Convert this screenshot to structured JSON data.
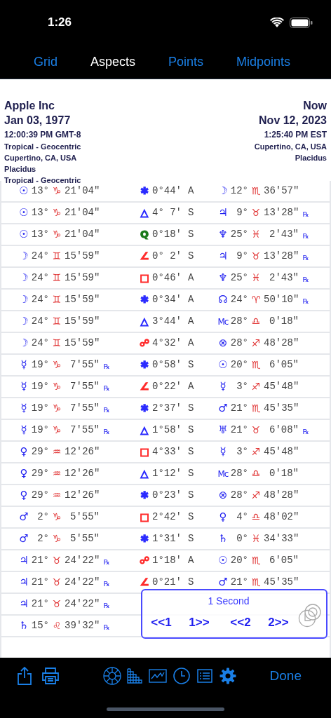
{
  "status_bar": {
    "time": "1:26"
  },
  "tabs": [
    {
      "label": "Grid",
      "selected": false
    },
    {
      "label": "Aspects",
      "selected": true
    },
    {
      "label": "Points",
      "selected": false
    },
    {
      "label": "Midpoints",
      "selected": false
    }
  ],
  "header": {
    "left": [
      {
        "kind": "title",
        "text": "Apple Inc"
      },
      {
        "kind": "date",
        "text": "Jan 03, 1977"
      },
      {
        "kind": "time",
        "text": "12:00:39 PM GMT-8"
      },
      {
        "kind": "detail",
        "text": "Tropical - Geocentric"
      },
      {
        "kind": "detail",
        "text": "Cupertino, CA, USA"
      },
      {
        "kind": "detail",
        "text": "Placidus"
      },
      {
        "kind": "detail",
        "text": "Tropical - Geocentric"
      }
    ],
    "right": [
      {
        "kind": "title",
        "text": "Now"
      },
      {
        "kind": "date",
        "text": "Nov 12, 2023"
      },
      {
        "kind": "time",
        "text": "1:25:40 PM EST"
      },
      {
        "kind": "detail",
        "text": "Cupertino, CA, USA"
      },
      {
        "kind": "detail",
        "text": "Placidus"
      }
    ]
  },
  "aspects": [
    {
      "p1": {
        "glyph": "☉",
        "deg": "13°",
        "sign": "♑",
        "min": "21'04\""
      },
      "aspect": {
        "glyph": "✱",
        "color": "#2b2bff",
        "orb": "0°44'",
        "mode": "A"
      },
      "p2": {
        "glyph": "☽",
        "deg": "12°",
        "sign": "♏",
        "min": "36'57\""
      }
    },
    {
      "p1": {
        "glyph": "☉",
        "deg": "13°",
        "sign": "♑",
        "min": "21'04\""
      },
      "aspect": {
        "glyph": "△",
        "color": "#2b2bff",
        "orb": "4° 7'",
        "mode": "S"
      },
      "p2": {
        "glyph": "♃",
        "deg": "9°",
        "sign": "♉",
        "min": "13'28\"",
        "rx": "℞"
      }
    },
    {
      "p1": {
        "glyph": "☉",
        "deg": "13°",
        "sign": "♑",
        "min": "21'04\""
      },
      "aspect": {
        "glyph": "Q",
        "color": "#1a7a1a",
        "orb": "0°18'",
        "mode": "S"
      },
      "p2": {
        "glyph": "♆",
        "deg": "25°",
        "sign": "♓",
        "min": "2'43\"",
        "rx": "℞"
      }
    },
    {
      "p1": {
        "glyph": "☽",
        "deg": "24°",
        "sign": "♊",
        "min": "15'59\""
      },
      "aspect": {
        "glyph": "∠",
        "color": "#ff2b2b",
        "orb": "0° 2'",
        "mode": "S"
      },
      "p2": {
        "glyph": "♃",
        "deg": "9°",
        "sign": "♉",
        "min": "13'28\"",
        "rx": "℞"
      }
    },
    {
      "p1": {
        "glyph": "☽",
        "deg": "24°",
        "sign": "♊",
        "min": "15'59\""
      },
      "aspect": {
        "glyph": "□",
        "color": "#ff2b2b",
        "orb": "0°46'",
        "mode": "A"
      },
      "p2": {
        "glyph": "♆",
        "deg": "25°",
        "sign": "♓",
        "min": "2'43\"",
        "rx": "℞"
      }
    },
    {
      "p1": {
        "glyph": "☽",
        "deg": "24°",
        "sign": "♊",
        "min": "15'59\""
      },
      "aspect": {
        "glyph": "✱",
        "color": "#2b2bff",
        "orb": "0°34'",
        "mode": "A"
      },
      "p2": {
        "glyph": "☊",
        "deg": "24°",
        "sign": "♈",
        "min": "50'10\"",
        "rx": "℞"
      }
    },
    {
      "p1": {
        "glyph": "☽",
        "deg": "24°",
        "sign": "♊",
        "min": "15'59\""
      },
      "aspect": {
        "glyph": "△",
        "color": "#2b2bff",
        "orb": "3°44'",
        "mode": "A"
      },
      "p2": {
        "glyph": "Mc",
        "deg": "28°",
        "sign": "♎",
        "min": "0'18\""
      }
    },
    {
      "p1": {
        "glyph": "☽",
        "deg": "24°",
        "sign": "♊",
        "min": "15'59\""
      },
      "aspect": {
        "glyph": "☍",
        "color": "#ff2b2b",
        "orb": "4°32'",
        "mode": "A"
      },
      "p2": {
        "glyph": "⊗",
        "deg": "28°",
        "sign": "♐",
        "min": "48'28\""
      }
    },
    {
      "p1": {
        "glyph": "☿",
        "deg": "19°",
        "sign": "♑",
        "min": "7'55\"",
        "rx": "℞"
      },
      "aspect": {
        "glyph": "✱",
        "color": "#2b2bff",
        "orb": "0°58'",
        "mode": "S"
      },
      "p2": {
        "glyph": "☉",
        "deg": "20°",
        "sign": "♏",
        "min": "6'05\""
      }
    },
    {
      "p1": {
        "glyph": "☿",
        "deg": "19°",
        "sign": "♑",
        "min": "7'55\"",
        "rx": "℞"
      },
      "aspect": {
        "glyph": "∠",
        "color": "#ff2b2b",
        "orb": "0°22'",
        "mode": "A"
      },
      "p2": {
        "glyph": "☿",
        "deg": "3°",
        "sign": "♐",
        "min": "45'48\""
      }
    },
    {
      "p1": {
        "glyph": "☿",
        "deg": "19°",
        "sign": "♑",
        "min": "7'55\"",
        "rx": "℞"
      },
      "aspect": {
        "glyph": "✱",
        "color": "#2b2bff",
        "orb": "2°37'",
        "mode": "S"
      },
      "p2": {
        "glyph": "♂",
        "deg": "21°",
        "sign": "♏",
        "min": "45'35\""
      }
    },
    {
      "p1": {
        "glyph": "☿",
        "deg": "19°",
        "sign": "♑",
        "min": "7'55\"",
        "rx": "℞"
      },
      "aspect": {
        "glyph": "△",
        "color": "#2b2bff",
        "orb": "1°58'",
        "mode": "S"
      },
      "p2": {
        "glyph": "♅",
        "deg": "21°",
        "sign": "♉",
        "min": "6'08\"",
        "rx": "℞"
      }
    },
    {
      "p1": {
        "glyph": "♀",
        "deg": "29°",
        "sign": "♒",
        "min": "12'26\""
      },
      "aspect": {
        "glyph": "□",
        "color": "#ff2b2b",
        "orb": "4°33'",
        "mode": "S"
      },
      "p2": {
        "glyph": "☿",
        "deg": "3°",
        "sign": "♐",
        "min": "45'48\""
      }
    },
    {
      "p1": {
        "glyph": "♀",
        "deg": "29°",
        "sign": "♒",
        "min": "12'26\""
      },
      "aspect": {
        "glyph": "△",
        "color": "#2b2bff",
        "orb": "1°12'",
        "mode": "S"
      },
      "p2": {
        "glyph": "Mc",
        "deg": "28°",
        "sign": "♎",
        "min": "0'18\""
      }
    },
    {
      "p1": {
        "glyph": "♀",
        "deg": "29°",
        "sign": "♒",
        "min": "12'26\""
      },
      "aspect": {
        "glyph": "✱",
        "color": "#2b2bff",
        "orb": "0°23'",
        "mode": "S"
      },
      "p2": {
        "glyph": "⊗",
        "deg": "28°",
        "sign": "♐",
        "min": "48'28\""
      }
    },
    {
      "p1": {
        "glyph": "♂",
        "deg": "2°",
        "sign": "♑",
        "min": "5'55\""
      },
      "aspect": {
        "glyph": "□",
        "color": "#ff2b2b",
        "orb": "2°42'",
        "mode": "S"
      },
      "p2": {
        "glyph": "♀",
        "deg": "4°",
        "sign": "♎",
        "min": "48'02\""
      }
    },
    {
      "p1": {
        "glyph": "♂",
        "deg": "2°",
        "sign": "♑",
        "min": "5'55\""
      },
      "aspect": {
        "glyph": "✱",
        "color": "#2b2bff",
        "orb": "1°31'",
        "mode": "S"
      },
      "p2": {
        "glyph": "♄",
        "deg": "0°",
        "sign": "♓",
        "min": "34'33\""
      }
    },
    {
      "p1": {
        "glyph": "♃",
        "deg": "21°",
        "sign": "♉",
        "min": "24'22\"",
        "rx": "℞"
      },
      "aspect": {
        "glyph": "☍",
        "color": "#ff2b2b",
        "orb": "1°18'",
        "mode": "A"
      },
      "p2": {
        "glyph": "☉",
        "deg": "20°",
        "sign": "♏",
        "min": "6'05\""
      }
    },
    {
      "p1": {
        "glyph": "♃",
        "deg": "21°",
        "sign": "♉",
        "min": "24'22\"",
        "rx": "℞"
      },
      "aspect": {
        "glyph": "∠",
        "color": "#ff2b2b",
        "orb": "0°21'",
        "mode": "S"
      },
      "p2": {
        "glyph": "♂",
        "deg": "21°",
        "sign": "♏",
        "min": "45'35\""
      }
    },
    {
      "p1": {
        "glyph": "♃",
        "deg": "21°",
        "sign": "♉",
        "min": "24'22\"",
        "rx": "℞"
      }
    },
    {
      "p1": {
        "glyph": "♄",
        "deg": "15°",
        "sign": "♌",
        "min": "39'32\"",
        "rx": "℞"
      }
    }
  ],
  "stepper": {
    "title": "1 Second",
    "buttons": [
      "<<1",
      "1>>",
      "<<2",
      "2>>"
    ]
  },
  "toolbar": {
    "done": "Done"
  }
}
